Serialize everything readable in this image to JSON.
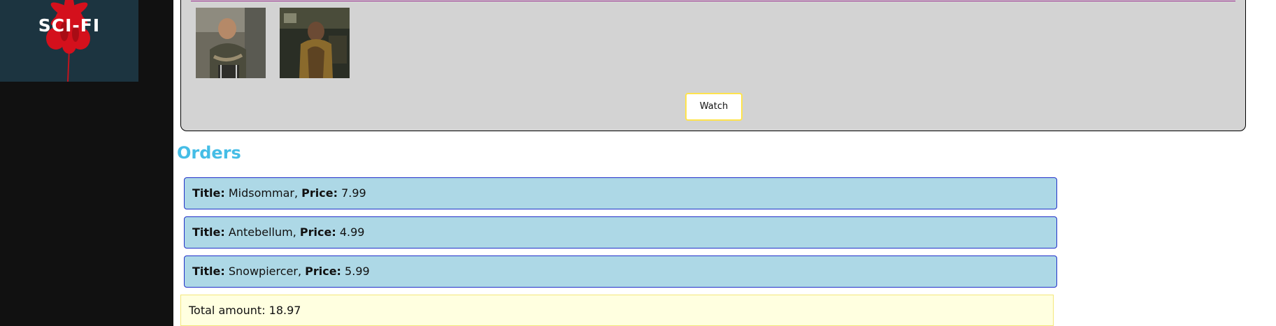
{
  "sidebar": {
    "genre_tile": {
      "label": "SCI-FI"
    }
  },
  "movie_card": {
    "stills": [
      {
        "name": "movie-still-1"
      },
      {
        "name": "movie-still-2"
      }
    ],
    "watch_label": "Watch"
  },
  "orders": {
    "heading": "Orders",
    "title_key": "Title:",
    "price_key": "Price:",
    "items": [
      {
        "title": "Midsommar",
        "price": "7.99"
      },
      {
        "title": "Antebellum",
        "price": "4.99"
      },
      {
        "title": "Snowpiercer",
        "price": "5.99"
      }
    ],
    "total_label": "Total amount:",
    "total_value": "18.97"
  },
  "colors": {
    "sidebar_bg": "#111111",
    "card_bg": "#d3d3d3",
    "card_divider": "#9c2e91",
    "watch_border": "#ffe34d",
    "orders_heading": "#45bde6",
    "order_row_bg": "#add8e6",
    "order_row_border": "#1f30c9",
    "total_bg": "#ffffe0"
  }
}
